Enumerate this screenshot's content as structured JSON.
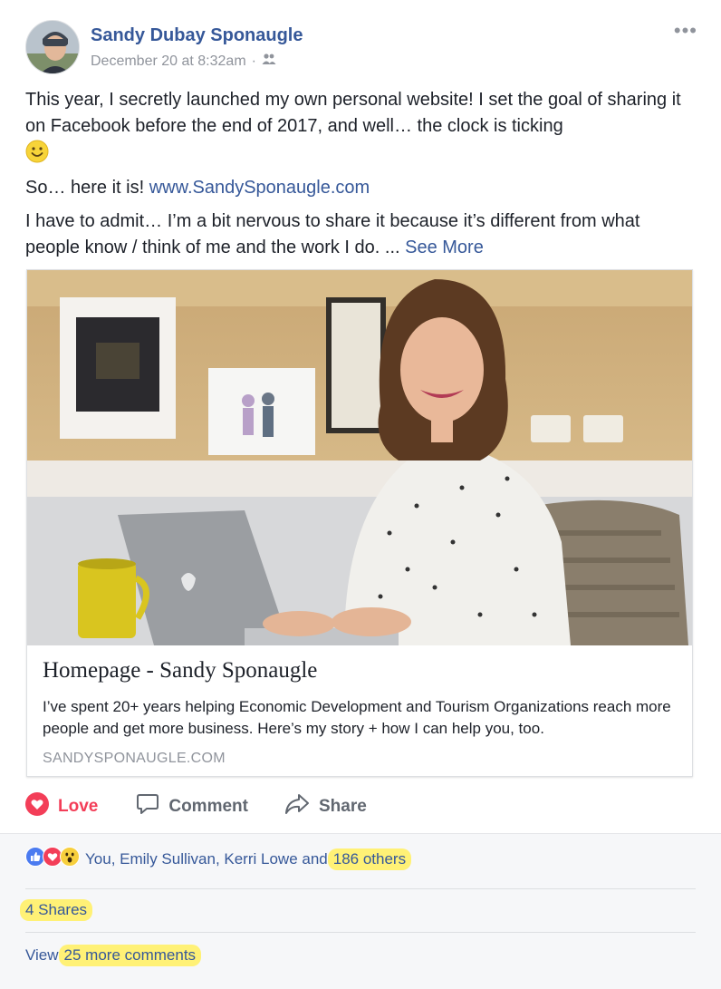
{
  "post": {
    "author": "Sandy Dubay Sponaugle",
    "timestamp": "December 20 at 8:32am",
    "separator": "·",
    "audience_icon": "friends-icon",
    "more_label": "•••",
    "paragraph1": "This year, I secretly launched my own personal website! I set the goal of sharing it on Facebook before the end of 2017, and well… the clock is ticking",
    "p2_prefix": "So… here it is! ",
    "p2_link": "www.SandySponaugle.com",
    "paragraph3": "I have to admit… I’m a bit nervous to share it because it’s different from what people know / think of me and the work I do. ... ",
    "see_more": "See More"
  },
  "card": {
    "title": "Homepage - Sandy Sponaugle",
    "description": "I’ve spent 20+ years helping Economic Development and Tourism Organizations reach more people and get more business. Here’s my story + how I can help you, too.",
    "domain": "SANDYSPONAUGLE.COM"
  },
  "actions": {
    "love": "Love",
    "comment": "Comment",
    "share": "Share"
  },
  "reactions": {
    "names": "You, Emily Sullivan, Kerri Lowe and ",
    "others": "186 others"
  },
  "shares": "4 Shares",
  "comments": {
    "prefix": "View ",
    "count_text": "25 more comments"
  },
  "colors": {
    "link": "#365899",
    "love": "#f33e58",
    "highlight": "#fff176"
  }
}
